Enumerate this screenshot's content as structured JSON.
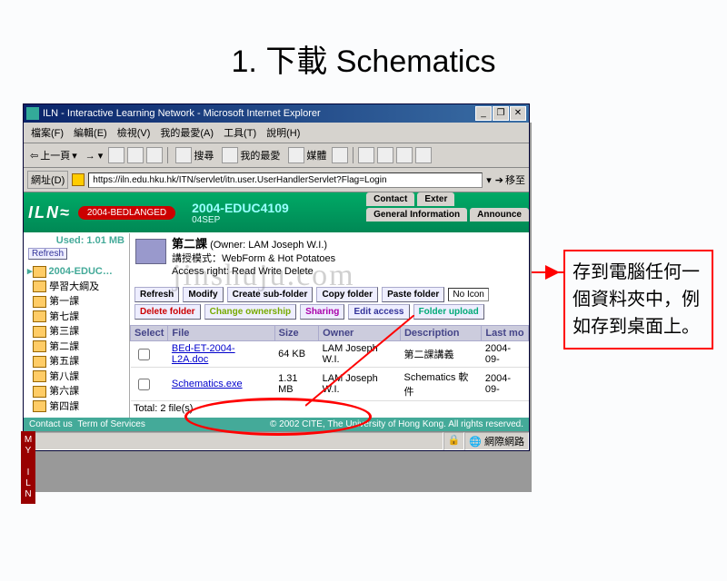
{
  "slide": {
    "title": "1. 下載 Schematics"
  },
  "annotation": "存到電腦任何一個資料夾中，例如存到桌面上。",
  "watermark": "jinshuju.com",
  "window": {
    "title": "ILN - Interactive Learning Network - Microsoft Internet Explorer",
    "ctrl": {
      "min": "_",
      "max": "❐",
      "close": "✕"
    },
    "menu": [
      "檔案(F)",
      "編輯(E)",
      "檢視(V)",
      "我的最愛(A)",
      "工具(T)",
      "說明(H)"
    ],
    "toolbar": {
      "back": "上一頁",
      "srch": "搜尋",
      "fav": "我的最愛",
      "media": "媒體"
    },
    "addr": {
      "label": "網址(D)",
      "url": "https://iln.edu.hku.hk/ITN/servlet/itn.user.UserHandlerServlet?Flag=Login",
      "go": "移至"
    },
    "app": {
      "logo": "ILN≈",
      "pill": "2004-BEDLANGED",
      "course": "2004-EDUC4109",
      "coursesub": "04SEP",
      "tabs": [
        "Contact",
        "Exter",
        "General Information",
        "Announce"
      ]
    },
    "left": {
      "used": "Used: 1.01 MB",
      "refresh": "Refresh",
      "root": "2004-EDUC…",
      "items": [
        "學習大綱及",
        "第一課",
        "第七課",
        "第三課",
        "第二課",
        "第五課",
        "第八課",
        "第六課",
        "第四課"
      ]
    },
    "myiln": "MY ILN",
    "panel": {
      "title": "第二課",
      "owner": "(Owner: LAM Joseph W.I.)",
      "mode": "講授模式：WebForm & Hot Potatoes",
      "access": "Access right:  Read Write Delete",
      "buttons1": [
        "Refresh",
        "Modify",
        "Create sub-folder",
        "Copy folder",
        "Paste folder"
      ],
      "iconsel": "No Icon",
      "buttons2": [
        {
          "t": "Delete folder",
          "c": "del"
        },
        {
          "t": "Change ownership",
          "c": "chg"
        },
        {
          "t": "Sharing",
          "c": "shr"
        },
        {
          "t": "Edit access",
          "c": "edt"
        },
        {
          "t": "Folder upload",
          "c": "upl"
        }
      ],
      "cols": [
        "Select",
        "File",
        "Size",
        "Owner",
        "Description",
        "Last mo"
      ],
      "rows": [
        {
          "file": "BEd-ET-2004-L2A.doc",
          "size": "64 KB",
          "owner": "LAM Joseph W.I.",
          "desc": "第二課講義",
          "last": "2004-09-"
        },
        {
          "file": "Schematics.exe",
          "size": "1.31 MB",
          "owner": "LAM Joseph W.I.",
          "desc": "Schematics 軟件",
          "last": "2004-09-"
        }
      ],
      "total": "Total: 2 file(s)"
    },
    "footer": {
      "l1": "Contact us",
      "l2": "Term of Services",
      "r": "© 2002 CITE, The University of Hong Kong. All rights reserved."
    },
    "status": {
      "lock": "🔒",
      "zone": "網際網路"
    }
  }
}
